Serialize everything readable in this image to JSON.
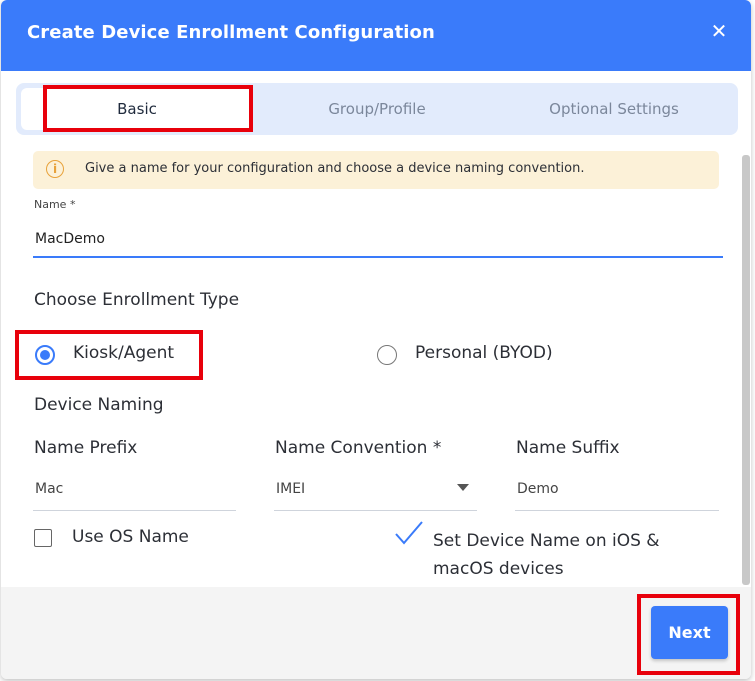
{
  "dialog": {
    "title": "Create Device Enrollment Configuration",
    "close_icon": "close-icon",
    "close_glyph": "✕"
  },
  "tabs": [
    {
      "label": "Basic",
      "active": true
    },
    {
      "label": "Group/Profile",
      "active": false
    },
    {
      "label": "Optional Settings",
      "active": false
    }
  ],
  "info": {
    "icon": "info-icon",
    "icon_glyph": "i",
    "text": "Give a name for your configuration and choose a device naming convention."
  },
  "name_field": {
    "label": "Name *",
    "value": "MacDemo"
  },
  "enrollment": {
    "title": "Choose Enrollment Type",
    "options": [
      {
        "label": "Kiosk/Agent",
        "selected": true
      },
      {
        "label": "Personal (BYOD)",
        "selected": false
      }
    ]
  },
  "device_naming": {
    "title": "Device Naming",
    "prefix_label": "Name Prefix",
    "prefix_value": "Mac",
    "convention_label": "Name Convention *",
    "convention_value": "IMEI",
    "suffix_label": "Name Suffix",
    "suffix_value": "Demo",
    "use_os_name_label": "Use OS Name",
    "use_os_name_checked": false,
    "set_device_name_label": "Set Device Name on iOS & macOS devices",
    "set_device_name_checked": true
  },
  "footer": {
    "next_label": "Next"
  },
  "colors": {
    "header": "#3a7bfa",
    "accent": "#3a7bfa",
    "info_bg": "#fcf1d8",
    "info_icon": "#e8a23a",
    "highlight": "#e8000b"
  }
}
